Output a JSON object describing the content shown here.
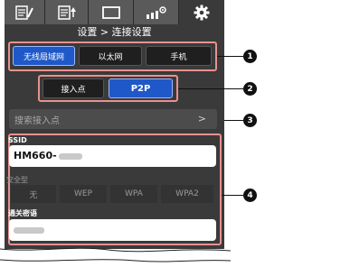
{
  "tabs": [
    {
      "icon": "list-edit-icon"
    },
    {
      "icon": "list-upload-icon"
    },
    {
      "icon": "screen-icon"
    },
    {
      "icon": "bars-gear-icon"
    },
    {
      "icon": "gear-icon",
      "active": true
    }
  ],
  "page_title": "设置 > 连接设置",
  "connection_types": [
    "无线局域网",
    "以太网",
    "手机"
  ],
  "selected_connection": "无线局域网",
  "wlan_modes": [
    "接入点",
    "P2P"
  ],
  "selected_mode": "P2P",
  "search": {
    "label": "搜索接入点",
    "arrow": ">"
  },
  "ssid": {
    "label": "SSID",
    "value": "HM660-"
  },
  "security": {
    "label": "安全型",
    "options": [
      "无",
      "WEP",
      "WPA",
      "WPA2"
    ]
  },
  "passphrase": {
    "label": "通关密语"
  },
  "callouts": [
    "1",
    "2",
    "3",
    "4"
  ],
  "colors": {
    "accent": "#1f58c8",
    "highlight": "#e8918f",
    "background": "#3a3a3a"
  }
}
